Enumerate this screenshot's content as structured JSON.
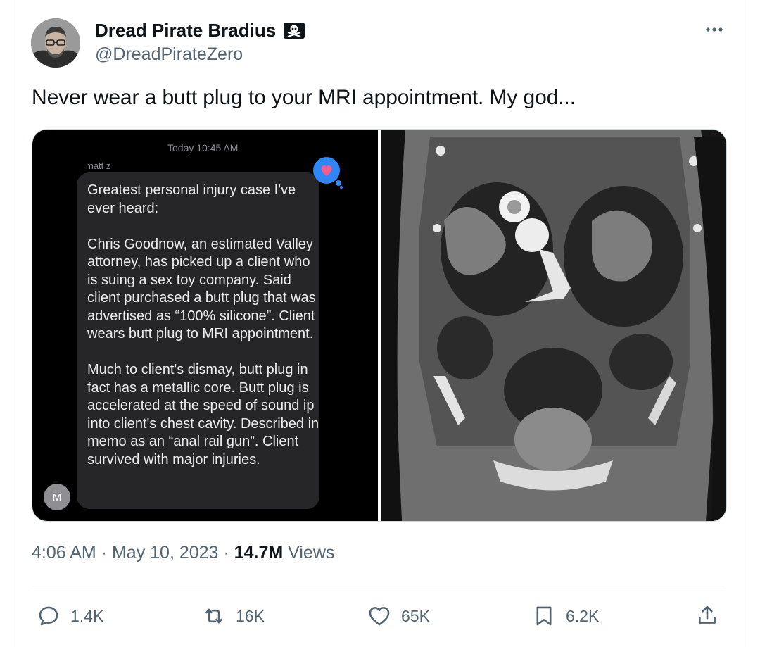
{
  "author": {
    "name": "Dread Pirate Bradius",
    "handle": "@DreadPirateZero",
    "badge_icon": "skull-crossbones-badge-icon"
  },
  "tweet": {
    "text": "Never wear a butt plug to your MRI appointment. My god..."
  },
  "message_screenshot": {
    "timestamp": "Today 10:45 AM",
    "sender": "matt z",
    "avatar_initial": "M",
    "body": "Greatest personal injury case I've ever heard:\n\nChris Goodnow, an estimated Valley attorney, has picked up a client who is suing a sex toy company. Said client purchased a butt plug that was advertised as “100% silicone”. Client wears butt plug to MRI appointment.\n\nMuch to client's dismay, butt plug in fact has a metallic core. Butt plug is accelerated at the speed of sound ip into client's chest cavity. Described in memo as an “anal rail gun”. Client survived with major injuries."
  },
  "meta": {
    "time": "4:06 AM",
    "date": "May 10, 2023",
    "separator": "·",
    "views_count": "14.7M",
    "views_label": "Views"
  },
  "actions": {
    "replies": "1.4K",
    "reposts": "16K",
    "likes": "65K",
    "bookmarks": "6.2K"
  },
  "colors": {
    "text_primary": "#0f1419",
    "text_secondary": "#536471",
    "divider": "#eff3f4",
    "bubble_bg": "#262628"
  }
}
